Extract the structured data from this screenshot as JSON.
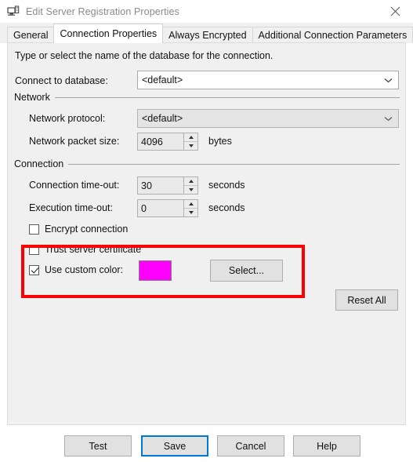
{
  "window": {
    "title": "Edit Server Registration Properties",
    "icon": "server-computer-icon",
    "close_label": "×"
  },
  "tabs": [
    {
      "label": "General",
      "active": false
    },
    {
      "label": "Connection Properties",
      "active": true
    },
    {
      "label": "Always Encrypted",
      "active": false
    },
    {
      "label": "Additional Connection Parameters",
      "active": false
    }
  ],
  "panel": {
    "intro": "Type or select the name of the database for the connection.",
    "connect_to_database": {
      "label": "Connect to database:",
      "value": "<default>"
    },
    "network_group": {
      "title": "Network",
      "protocol": {
        "label": "Network protocol:",
        "value": "<default>"
      },
      "packet_size": {
        "label": "Network packet size:",
        "value": "4096",
        "unit": "bytes"
      }
    },
    "connection_group": {
      "title": "Connection",
      "connection_timeout": {
        "label": "Connection time-out:",
        "value": "30",
        "unit": "seconds"
      },
      "execution_timeout": {
        "label": "Execution time-out:",
        "value": "0",
        "unit": "seconds"
      },
      "encrypt_connection": {
        "label": "Encrypt connection",
        "checked": false
      },
      "trust_server_certificate": {
        "label": "Trust server certificate",
        "checked": false
      },
      "use_custom_color": {
        "label": "Use custom color:",
        "checked": true,
        "color": "#FF00FF"
      },
      "select_button": "Select..."
    },
    "reset_all_button": "Reset All"
  },
  "annotation": {
    "color": "#FF0000"
  },
  "footer": {
    "buttons": [
      {
        "label": "Test",
        "focused": false
      },
      {
        "label": "Save",
        "focused": true
      },
      {
        "label": "Cancel",
        "focused": false
      },
      {
        "label": "Help",
        "focused": false
      }
    ]
  }
}
